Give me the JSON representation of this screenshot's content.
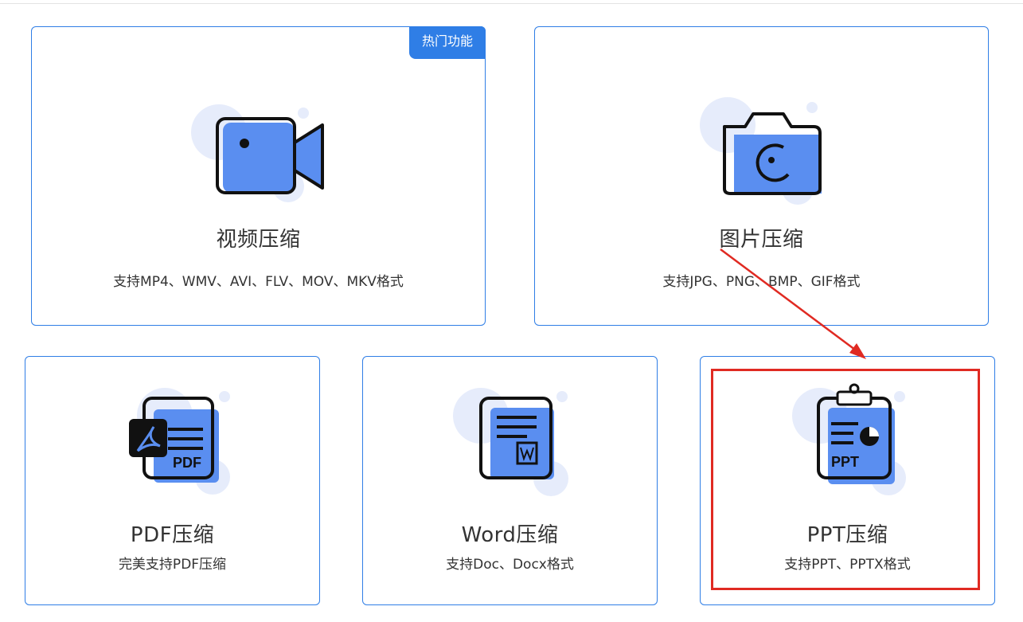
{
  "cards": {
    "video": {
      "title": "视频压缩",
      "desc": "支持MP4、WMV、AVI、FLV、MOV、MKV格式",
      "badge": "热门功能",
      "icon": "video-camera-icon"
    },
    "image": {
      "title": "图片压缩",
      "desc": "支持JPG、PNG、BMP、GIF格式",
      "icon": "camera-icon"
    },
    "pdf": {
      "title": "PDF压缩",
      "desc": "完美支持PDF压缩",
      "icon": "pdf-document-icon",
      "icon_text": "PDF"
    },
    "word": {
      "title": "Word压缩",
      "desc": "支持Doc、Docx格式",
      "icon": "word-document-icon"
    },
    "ppt": {
      "title": "PPT压缩",
      "desc": "支持PPT、PPTX格式",
      "icon": "ppt-clipboard-icon",
      "icon_text": "PPT"
    }
  },
  "colors": {
    "accent": "#2f7ee6",
    "icon_fill": "#5a8ef0",
    "icon_bg": "#e8eefc",
    "annotation": "#e02a22"
  }
}
